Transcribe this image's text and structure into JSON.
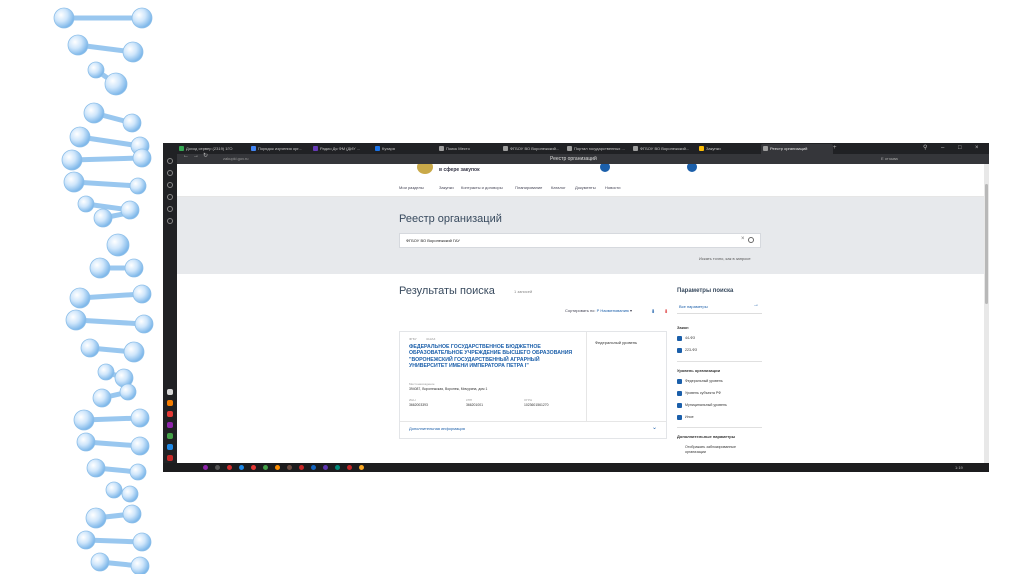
{
  "browser": {
    "tabs": [
      {
        "label": "Доход сервер (2319) 1ГО",
        "color": "#34a853"
      },
      {
        "label": "Порядок изучения орг...",
        "color": "#4285f4"
      },
      {
        "label": "Радио Дя ФМ (ДИУ ...",
        "color": "#673ab7"
      },
      {
        "label": "Кухаря",
        "color": "#1a73e8"
      },
      {
        "label": "Поиск Место",
        "color": "#9e9e9e"
      },
      {
        "label": "ФГБОУ ВО Воронежский...",
        "color": "#9e9e9e"
      },
      {
        "label": "Портал государственных ...",
        "color": "#9e9e9e"
      },
      {
        "label": "ФГБОУ ВО Воронежский...",
        "color": "#9e9e9e"
      },
      {
        "label": "Закупки",
        "color": "#fbbc05"
      },
      {
        "label": "Реестр организаций",
        "color": "#9e9e9e"
      }
    ],
    "url": "zakupki.gov.ru",
    "page_title": "Реестр организаций",
    "addr_right": "Е отзыва",
    "taskbar_time": "1:19"
  },
  "site": {
    "logo_text": "в сфере закупок",
    "nav": [
      "Мои разделы",
      "Закупки",
      "Контракты и договоры",
      "Планирование",
      "Каталог",
      "Документы",
      "Новости"
    ]
  },
  "hero": {
    "title": "Реестр организаций",
    "search_value": "ФГБОУ ВО Воронежский ГАУ",
    "hint": "Искать точно, как в запросе"
  },
  "results": {
    "title": "Результаты поиска",
    "count": "1 записей",
    "sort_label": "Сортировать по:",
    "sort_value": "Р  Наименованию",
    "card": {
      "tags": [
        "ФГБУ",
        "ЗАКАЗ"
      ],
      "org_name": "ФЕДЕРАЛЬНОЕ ГОСУДАРСТВЕННОЕ БЮДЖЕТНОЕ ОБРАЗОВАТЕЛЬНОЕ УЧРЕЖДЕНИЕ ВЫСШЕГО ОБРАЗОВАНИЯ \"ВОРОНЕЖСКИЙ ГОСУДАРСТВЕННЫЙ АГРАРНЫЙ УНИВЕРСИТЕТ ИМЕНИ ИМПЕРАТОРА ПЕТРА I\"",
      "location_label": "Местонахождение",
      "location": "394087, Воронежская, Воронеж, Мичурина, дом 1",
      "inn_label": "ИНН",
      "inn": "3662003393",
      "kpp_label": "КПП",
      "kpp": "366201001",
      "ogrn_label": "ОГРН",
      "ogrn": "1023601561270",
      "level": "Федеральный уровень",
      "more": "Дополнительная информация"
    }
  },
  "filters": {
    "title": "Параметры поиска",
    "all_params": "Все параметры",
    "law_group": "Закон",
    "laws": [
      "44-ФЗ",
      "223-ФЗ"
    ],
    "level_group": "Уровень организации",
    "levels": [
      "Федеральный уровень",
      "Уровень субъекта РФ",
      "Муниципальный уровень",
      "Иное"
    ],
    "extra_group": "Дополнительные параметры",
    "extra": "Отображать заблокированные организации"
  }
}
